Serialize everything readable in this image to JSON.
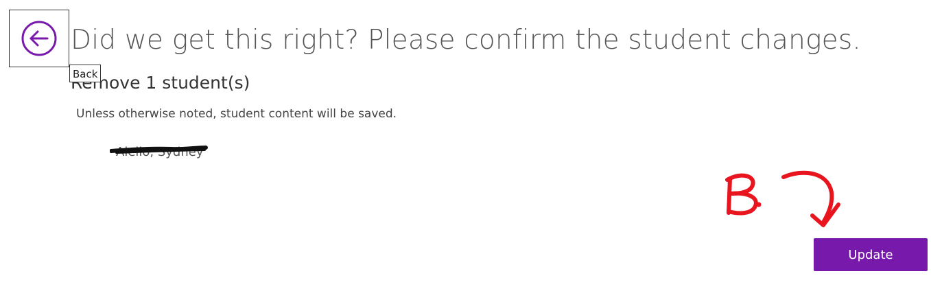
{
  "header": {
    "back_tooltip": "Back",
    "title": "Did we get this right? Please confirm the student changes."
  },
  "changes": {
    "heading": "Remove 1 student(s)",
    "note": "Unless otherwise noted, student content will be saved.",
    "students": [
      "Aiello, Sydney"
    ]
  },
  "annotation": {
    "label": "B."
  },
  "actions": {
    "update_label": "Update"
  },
  "colors": {
    "accent": "#7719aa",
    "annotation": "#e8141e",
    "redaction": "#111111"
  },
  "icons": {
    "back": "back-arrow-circle-icon"
  }
}
